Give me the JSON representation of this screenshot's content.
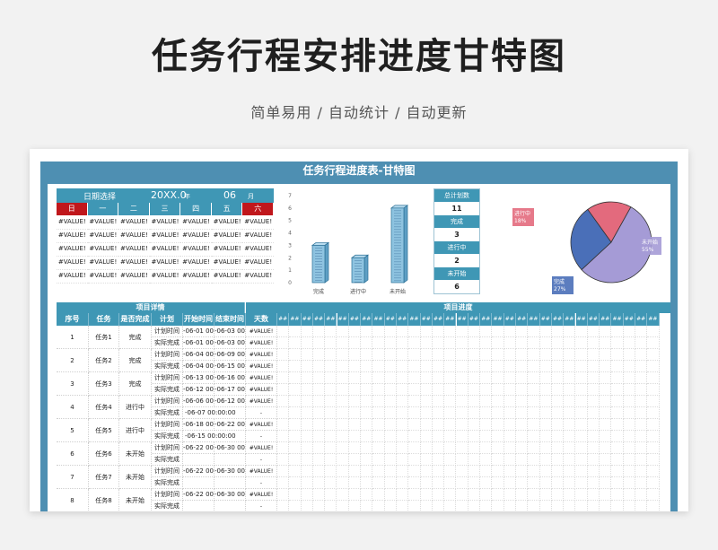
{
  "title": "任务行程安排进度甘特图",
  "subtitle": "简单易用 / 自动统计 / 自动更新",
  "sheet": {
    "title": "任务行程进度表-甘特图",
    "calendar": {
      "date_label": "日期选择",
      "year_value": "20XX.0",
      "year_unit": "年",
      "month_value": "06",
      "month_unit": "月",
      "weekdays": [
        "日",
        "一",
        "二",
        "三",
        "四",
        "五",
        "六"
      ],
      "cell_value": "#VALUE!",
      "rows": 5
    },
    "stats": {
      "items": [
        {
          "label": "总计划数",
          "value": "11"
        },
        {
          "label": "完成",
          "value": "3"
        },
        {
          "label": "进行中",
          "value": "2"
        },
        {
          "label": "未开始",
          "value": "6"
        }
      ]
    },
    "table": {
      "group_headers": {
        "details": "项目详情",
        "progress": "项目进度"
      },
      "columns": [
        "序号",
        "任务",
        "是否完成",
        "计划",
        "开始时间",
        "结束时间",
        "天数"
      ],
      "progress_col_label": "##",
      "progress_col_count": 32,
      "rows": [
        {
          "no": "1",
          "task": "任务1",
          "status": "完成",
          "plan_start": "-06-01 00:",
          "plan_end": "-06-03 00:",
          "plan_days": "#VALUE!",
          "act_start": "-06-01 00:",
          "act_end": "-06-03 00:",
          "act_days": "#VALUE!"
        },
        {
          "no": "2",
          "task": "任务2",
          "status": "完成",
          "plan_start": "-06-04 00:",
          "plan_end": "-06-09 00:",
          "plan_days": "#VALUE!",
          "act_start": "-06-04 00:",
          "act_end": "-06-15 00:",
          "act_days": "#VALUE!"
        },
        {
          "no": "3",
          "task": "任务3",
          "status": "完成",
          "plan_start": "-06-13 00:",
          "plan_end": "-06-16 00:",
          "plan_days": "#VALUE!",
          "act_start": "-06-12 00:",
          "act_end": "-06-17 00:",
          "act_days": "#VALUE!"
        },
        {
          "no": "4",
          "task": "任务4",
          "status": "进行中",
          "plan_start": "-06-06 00:",
          "plan_end": "-06-12 00:",
          "plan_days": "#VALUE!",
          "act_start": "-06-07 00:00:00",
          "act_end": "",
          "act_days": "-"
        },
        {
          "no": "5",
          "task": "任务5",
          "status": "进行中",
          "plan_start": "-06-18 00:",
          "plan_end": "-06-22 00:",
          "plan_days": "#VALUE!",
          "act_start": "-06-15 00:00:00",
          "act_end": "",
          "act_days": "-"
        },
        {
          "no": "6",
          "task": "任务6",
          "status": "未开始",
          "plan_start": "-06-22 00:",
          "plan_end": "-06-30 00:",
          "plan_days": "#VALUE!",
          "act_start": "",
          "act_end": "",
          "act_days": "-"
        },
        {
          "no": "7",
          "task": "任务7",
          "status": "未开始",
          "plan_start": "-06-22 00:",
          "plan_end": "-06-30 00:",
          "plan_days": "#VALUE!",
          "act_start": "",
          "act_end": "",
          "act_days": "-"
        },
        {
          "no": "8",
          "task": "任务8",
          "status": "未开始",
          "plan_start": "-06-22 00:",
          "plan_end": "-06-30 00:",
          "plan_days": "#VALUE!",
          "act_start": "",
          "act_end": "",
          "act_days": "-"
        }
      ],
      "plan_label": "计划时间",
      "actual_label": "实际完成"
    }
  },
  "chart_data": [
    {
      "type": "bar",
      "categories": [
        "完成",
        "进行中",
        "未开始"
      ],
      "values": [
        3,
        2,
        6
      ],
      "ylim": [
        0,
        7
      ],
      "yticks": [
        "0",
        "1",
        "2",
        "3",
        "4",
        "5",
        "6",
        "7"
      ],
      "colors": {
        "bar": "#8ec3e0",
        "bar_edge": "#2a6f95"
      }
    },
    {
      "type": "pie",
      "labels": [
        "进行中",
        "未开始",
        "完成"
      ],
      "values": [
        18,
        55,
        27
      ],
      "display": [
        "18%",
        "55%",
        "27%"
      ],
      "colors": [
        "#e36a7d",
        "#a59bd6",
        "#4a6fb8"
      ]
    }
  ]
}
